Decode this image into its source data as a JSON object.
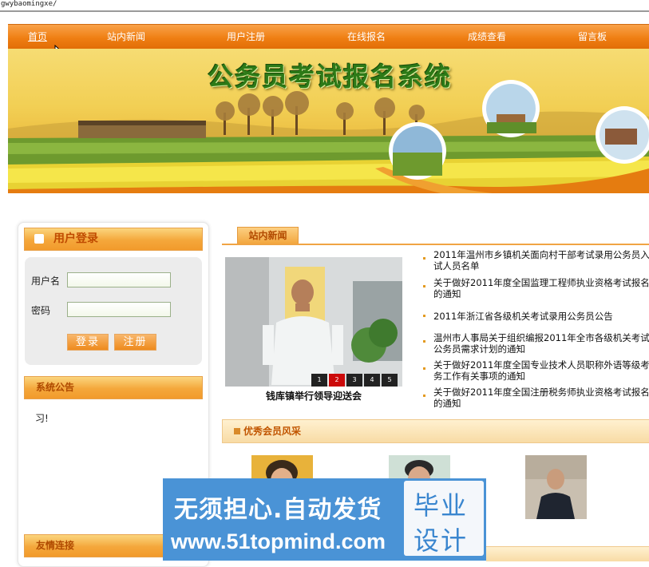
{
  "address_bar": {
    "url": "gwybaomingxe/"
  },
  "nav": {
    "items": [
      {
        "label": "首页"
      },
      {
        "label": "站内新闻"
      },
      {
        "label": "用户注册"
      },
      {
        "label": "在线报名"
      },
      {
        "label": "成绩查看"
      },
      {
        "label": "留言板"
      }
    ],
    "active_index": 0
  },
  "banner": {
    "title": "公务员考试报名系统"
  },
  "sidebar": {
    "login": {
      "title": "用户登录",
      "username_label": "用户名",
      "username_value": "",
      "password_label": "密码",
      "password_value": "",
      "login_button": "登录",
      "register_button": "注册"
    },
    "announcement": {
      "title": "系统公告",
      "text": "习!"
    },
    "links": {
      "title": "友情连接"
    }
  },
  "news": {
    "tab_label": "站内新闻",
    "photo_caption": "钱库镇举行领导迎送会",
    "pager": [
      "1",
      "2",
      "3",
      "4",
      "5"
    ],
    "pager_active": 1,
    "items": [
      {
        "line1": "2011年温州市乡镇机关面向村干部考试录用公务员入",
        "line2": "试人员名单"
      },
      {
        "line1": "关于做好2011年度全国监理工程师执业资格考试报名",
        "line2": "的通知"
      },
      {
        "line1": "2011年浙江省各级机关考试录用公务员公告",
        "line2": ""
      },
      {
        "line1": "温州市人事局关于组织编报2011年全市各级机关考试",
        "line2": "公务员需求计划的通知"
      },
      {
        "line1": "关于做好2011年度全国专业技术人员职称外语等级考",
        "line2": "务工作有关事项的通知"
      },
      {
        "line1": "关于做好2011年度全国注册税务师执业资格考试报名",
        "line2": "的通知"
      }
    ]
  },
  "members": {
    "title": "优秀会员风采"
  },
  "watermark": {
    "slogan": "无须担心.自动发货",
    "url": "www.51topmind.com",
    "badge_line1": "毕业",
    "badge_line2": "设计"
  },
  "colors": {
    "accent_orange": "#ef7e12",
    "title_green": "#2d7a17",
    "heading_brown": "#b04a00",
    "watermark_blue": "#4a93d6"
  }
}
